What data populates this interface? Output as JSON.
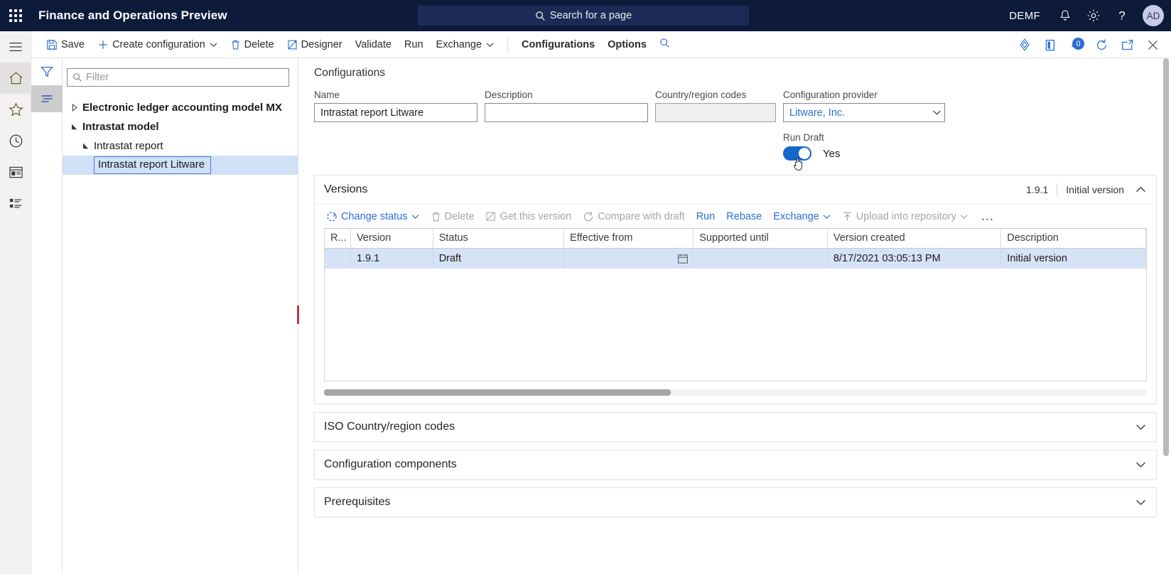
{
  "header": {
    "waffle_icon": "app-launcher-icon",
    "app_title": "Finance and Operations Preview",
    "search_placeholder": "Search for a page",
    "company": "DEMF",
    "notifications_icon": "bell-icon",
    "settings_icon": "gear-icon",
    "help_icon": "question-icon",
    "avatar_initials": "AD"
  },
  "command_bar": {
    "items": [
      {
        "label": "Save",
        "icon": "save-icon",
        "caret": false,
        "strong": false
      },
      {
        "label": "Create configuration",
        "icon": "plus-icon",
        "caret": true,
        "strong": false
      },
      {
        "label": "Delete",
        "icon": "trash-icon",
        "caret": false,
        "strong": false
      },
      {
        "label": "Designer",
        "icon": "designer-icon",
        "caret": false,
        "strong": false
      },
      {
        "label": "Validate",
        "icon": "",
        "caret": false,
        "strong": false
      },
      {
        "label": "Run",
        "icon": "",
        "caret": false,
        "strong": false
      },
      {
        "label": "Exchange",
        "icon": "",
        "caret": true,
        "strong": false
      }
    ],
    "tabs": [
      {
        "label": "Configurations"
      },
      {
        "label": "Options"
      }
    ],
    "search_icon": "search-icon",
    "right_icons": [
      "attachments-icon",
      "open-in-new-icon",
      "notifications-count-icon",
      "refresh-icon",
      "popout-icon",
      "close-icon"
    ],
    "notification_count": "0"
  },
  "nav_rail": {
    "items": [
      {
        "icon": "hamburger-menu-icon",
        "selected": false
      },
      {
        "icon": "home-icon",
        "selected": true
      },
      {
        "icon": "favorites-star-icon",
        "selected": false
      },
      {
        "icon": "recent-clock-icon",
        "selected": false
      },
      {
        "icon": "workspaces-icon",
        "selected": false
      },
      {
        "icon": "modules-list-icon",
        "selected": false
      }
    ]
  },
  "tree_rail": {
    "items": [
      {
        "icon": "filter-icon",
        "selected": false
      },
      {
        "icon": "tree-list-icon",
        "selected": true
      }
    ]
  },
  "tree_panel": {
    "filter_placeholder": "Filter",
    "filter_value": "",
    "filter_icon": "search-icon",
    "nodes": [
      {
        "label": "Electronic ledger accounting model MX",
        "level": 0,
        "state": "collapsed",
        "selected": false
      },
      {
        "label": "Intrastat model",
        "level": 0,
        "state": "expanded",
        "selected": false
      },
      {
        "label": "Intrastat report",
        "level": 1,
        "state": "expanded",
        "selected": false
      },
      {
        "label": "Intrastat report Litware",
        "level": 2,
        "state": "leaf",
        "selected": true
      }
    ]
  },
  "main": {
    "page_title": "Configurations",
    "fields": {
      "name": {
        "label": "Name",
        "value": "Intrastat report Litware",
        "placeholder": ""
      },
      "description": {
        "label": "Description",
        "value": "",
        "placeholder": ""
      },
      "country_region_codes": {
        "label": "Country/region codes",
        "value": "",
        "placeholder": "",
        "disabled": true
      },
      "configuration_provider": {
        "label": "Configuration provider",
        "value": "Litware, Inc.",
        "caret_icon": "chevron-down-icon"
      }
    },
    "run_draft": {
      "label": "Run Draft",
      "value": "Yes",
      "state": "on"
    }
  },
  "versions": {
    "title": "Versions",
    "summary_version": "1.9.1",
    "summary_description": "Initial version",
    "collapse_icon": "chevron-up-icon",
    "toolbar": [
      {
        "label": "Change status",
        "icon": "change-status-icon",
        "caret": true,
        "enabled": true
      },
      {
        "label": "Delete",
        "icon": "trash-icon",
        "caret": false,
        "enabled": false
      },
      {
        "label": "Get this version",
        "icon": "get-version-icon",
        "caret": false,
        "enabled": false
      },
      {
        "label": "Compare with draft",
        "icon": "compare-icon",
        "caret": false,
        "enabled": false
      },
      {
        "label": "Run",
        "icon": "",
        "caret": false,
        "enabled": true
      },
      {
        "label": "Rebase",
        "icon": "",
        "caret": false,
        "enabled": true
      },
      {
        "label": "Exchange",
        "icon": "",
        "caret": true,
        "enabled": true
      },
      {
        "label": "Upload into repository",
        "icon": "upload-icon",
        "caret": true,
        "enabled": false
      }
    ],
    "overflow_label": "…",
    "columns": [
      {
        "key": "r",
        "label": "R...",
        "cls": "c-r"
      },
      {
        "key": "version",
        "label": "Version",
        "cls": "c-ver"
      },
      {
        "key": "status",
        "label": "Status",
        "cls": "c-sta"
      },
      {
        "key": "effective_from",
        "label": "Effective from",
        "cls": "c-eff"
      },
      {
        "key": "supported_until",
        "label": "Supported until",
        "cls": "c-sup"
      },
      {
        "key": "version_created",
        "label": "Version created",
        "cls": "c-vcr"
      },
      {
        "key": "description",
        "label": "Description",
        "cls": "c-des"
      }
    ],
    "rows": [
      {
        "r": "",
        "version": "1.9.1",
        "status": "Draft",
        "effective_from": "",
        "supported_until": "",
        "version_created": "8/17/2021 03:05:13 PM",
        "description": "Initial version",
        "selected": true,
        "calendar_icon": "calendar-icon"
      }
    ]
  },
  "sections": [
    {
      "title": "ISO Country/region codes",
      "chevron": "chevron-down-icon"
    },
    {
      "title": "Configuration components",
      "chevron": "chevron-down-icon"
    },
    {
      "title": "Prerequisites",
      "chevron": "chevron-down-icon"
    }
  ],
  "colors": {
    "header_bg": "#0d1a3a",
    "accent_blue": "#2b6fd4",
    "toggle_on": "#1666cb",
    "row_selected": "#d6e3f7",
    "tree_selected": "#cfe0f7"
  }
}
